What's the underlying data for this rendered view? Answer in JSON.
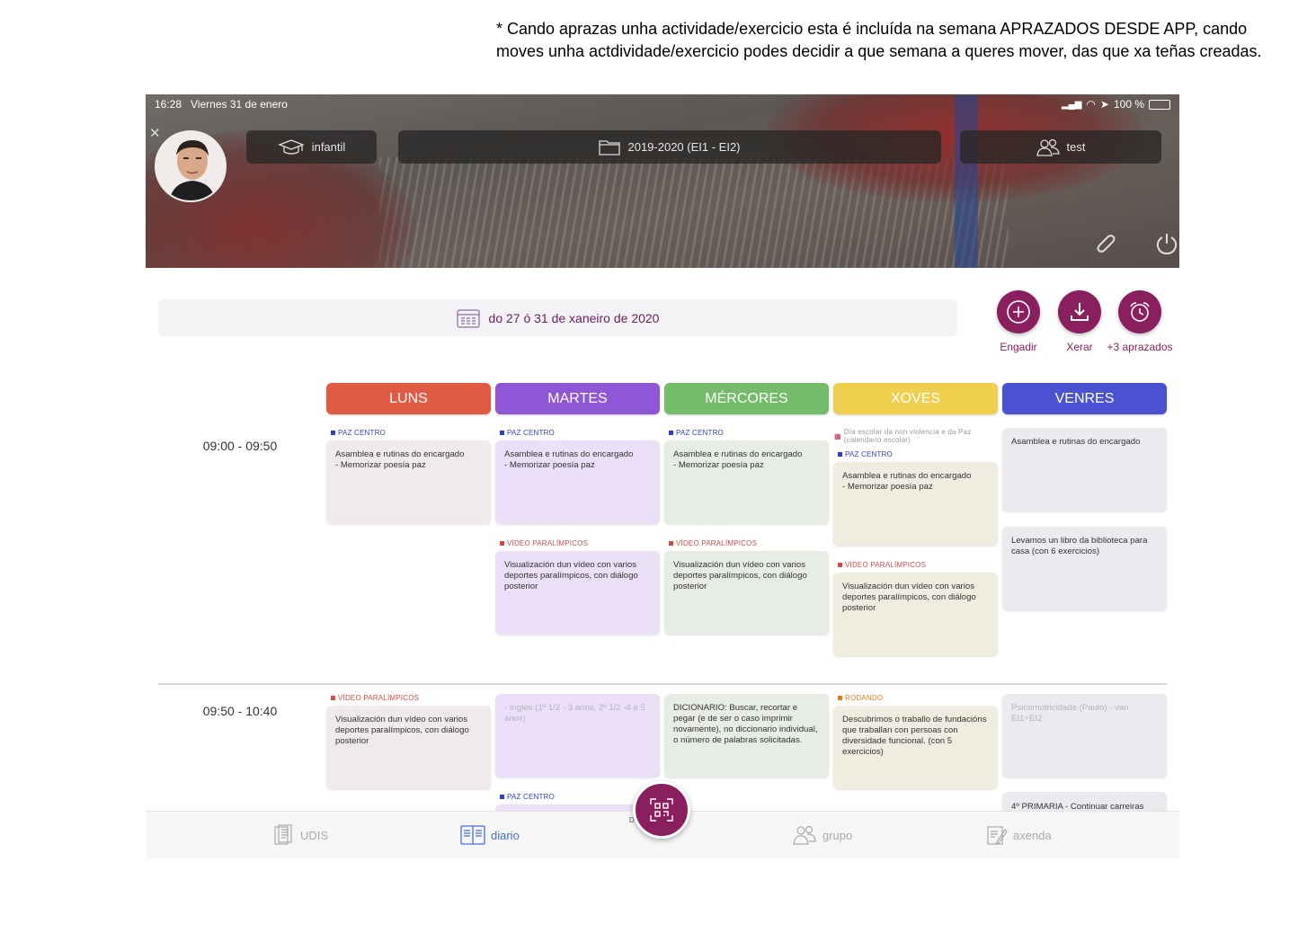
{
  "note": "* Cando aprazas unha actividade/exercicio esta é incluída na semana APRAZADOS DESDE APP, cando moves unha actdividade/exercicio podes decidir a que semana a queres mover, das que xa teñas creadas.",
  "status": {
    "time": "16:28",
    "date": "Viernes 31 de enero",
    "battery": "100 %"
  },
  "header": {
    "level": "infantil",
    "course": "2019-2020 (EI1 - EI2)",
    "group": "test"
  },
  "date_range": "do 27  ó 31 de xaneiro de 2020",
  "actions": {
    "add": "Engadir",
    "generate": "Xerar",
    "postponed": "+3 aprazados"
  },
  "days": [
    "LUNS",
    "MARTES",
    "MÉRCORES",
    "XOVES",
    "VENRES"
  ],
  "colors": {
    "luns": "#e05a44",
    "martes": "#8f56d6",
    "mercores": "#74bb6a",
    "xoves": "#f0cf4f",
    "venres": "#4a52d2",
    "accent": "#8a1f5f"
  },
  "times": [
    "09:00 - 09:50",
    "09:50 - 10:40"
  ],
  "slot1": {
    "tag_paz": "PAZ CENTRO",
    "tag_video": "VÍDEO PARALÍMPICOS",
    "asamblea": "Asamblea e rutinas do encargado\n  -  Memorizar poesía paz",
    "video": "Visualización dun vídeo con varios deportes paralímpicos, con diálogo posterior",
    "xoves_note": "Día escolar da non violencia e da Paz (calendario escolar)",
    "venres_asamblea": "Asamblea e rutinas do encargado",
    "venres_libro": "Levamos un libro da biblioteca para casa (con 6 exercicios)"
  },
  "slot2": {
    "tag_video": "VÍDEO PARALÍMPICOS",
    "tag_rodando": "RODANDO",
    "tag_paz": "PAZ CENTRO",
    "luns_video": "Visualización dun vídeo con varios deportes paralímpicos, con diálogo posterior",
    "martes_ingles": "- Inglés (1º 1/2 - 3 anos,  2º 1/2 -4 e 5 anos)",
    "mercores_dic": "DICIONARIO: Buscar, recortar e pegar (e de ser o caso imprimir novamente), no diccionario individual, o número de palabras solicitadas.",
    "xoves_desc": "Descubrimos o traballo de fundacións que traballan con persoas con diversidade funcional. (con 5 exercicios)",
    "venres_psico": "Psicomotricidade (Paulo) - van EI1+EI2",
    "venres_primaria": "4º PRIMARIA - Continuar carreiras"
  },
  "nav": {
    "udis": "UDIS",
    "diario": "diario",
    "grupo": "grupo",
    "axenda": "axenda",
    "center_label": "D"
  }
}
